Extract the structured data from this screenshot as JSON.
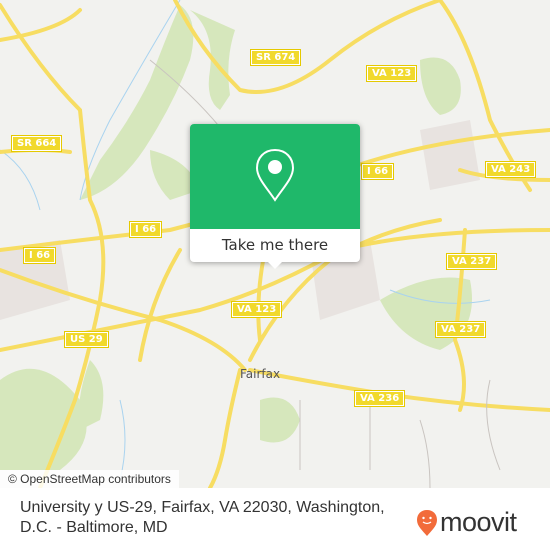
{
  "map": {
    "road_labels": [
      "SR 674",
      "VA 123",
      "SR 664",
      "I 66",
      "I 66",
      "VA 243",
      "VA 237",
      "VA 237",
      "VA 123",
      "US 29",
      "VA 236",
      "I 66"
    ],
    "place_label": "Fairfax",
    "attribution": "© OpenStreetMap contributors",
    "colors": {
      "background": "#f2f2ef",
      "road": "#f7dd62",
      "park": "#d4e6b5",
      "water": "#a9d3ef"
    }
  },
  "popup": {
    "icon": "location-pin-icon",
    "button_label": "Take me there",
    "accent_color": "#1fb86a"
  },
  "footer": {
    "address": "University y US-29, Fairfax, VA 22030, Washington, D.C. - Baltimore, MD",
    "logo_text": "moovit",
    "logo_icon": "moovit-pin-icon",
    "logo_color": "#f26b3a"
  }
}
